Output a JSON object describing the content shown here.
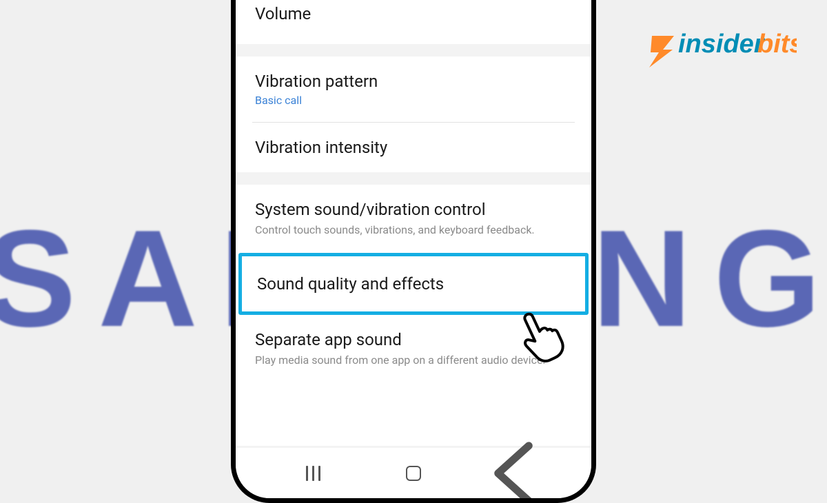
{
  "background": {
    "brand_text": "SAMSUNG"
  },
  "logo": {
    "name": "insiderbits"
  },
  "settings": {
    "items": [
      {
        "title": "Volume"
      },
      {
        "title": "Vibration pattern",
        "subtitle": "Basic call"
      },
      {
        "title": "Vibration intensity"
      },
      {
        "title": "System sound/vibration control",
        "desc": "Control touch sounds, vibrations, and keyboard feedback."
      },
      {
        "title": "Sound quality and effects",
        "highlighted": true
      },
      {
        "title": "Separate app sound",
        "desc": "Play media sound from one app on a different audio device."
      }
    ]
  },
  "nav": {
    "recents": "Recents",
    "home": "Home",
    "back": "Back"
  }
}
